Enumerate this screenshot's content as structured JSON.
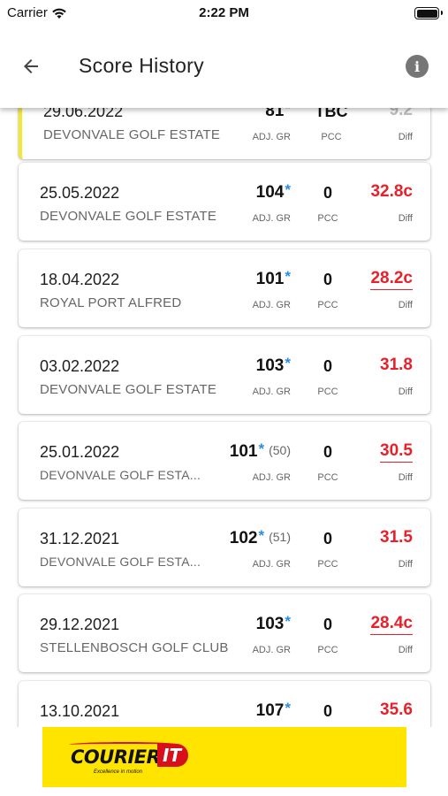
{
  "status_bar": {
    "carrier": "Carrier",
    "time": "2:22 PM"
  },
  "app_bar": {
    "title": "Score History",
    "info_glyph": "i"
  },
  "labels": {
    "adj": "ADJ. GR",
    "pcc": "PCC",
    "diff": "Diff"
  },
  "scores": [
    {
      "date": "29.06.2022",
      "course": "DEVONVALE GOLF ESTATE",
      "adj_gross": "81",
      "starred": true,
      "previous": "",
      "pcc": "TBC",
      "diff": "9.2",
      "diff_style": "faded",
      "underlined": false,
      "highlighted": true
    },
    {
      "date": "25.05.2022",
      "course": "DEVONVALE GOLF ESTATE",
      "adj_gross": "104",
      "starred": true,
      "previous": "",
      "pcc": "0",
      "diff": "32.8c",
      "diff_style": "red",
      "underlined": false,
      "highlighted": false
    },
    {
      "date": "18.04.2022",
      "course": "ROYAL PORT ALFRED",
      "adj_gross": "101",
      "starred": true,
      "previous": "",
      "pcc": "0",
      "diff": "28.2c",
      "diff_style": "red",
      "underlined": true,
      "highlighted": false
    },
    {
      "date": "03.02.2022",
      "course": "DEVONVALE GOLF ESTATE",
      "adj_gross": "103",
      "starred": true,
      "previous": "",
      "pcc": "0",
      "diff": "31.8",
      "diff_style": "red",
      "underlined": false,
      "highlighted": false
    },
    {
      "date": "25.01.2022",
      "course": "DEVONVALE GOLF ESTA...",
      "adj_gross": "101",
      "starred": true,
      "previous": "(50)",
      "pcc": "0",
      "diff": "30.5",
      "diff_style": "red",
      "underlined": true,
      "highlighted": false
    },
    {
      "date": "31.12.2021",
      "course": "DEVONVALE GOLF ESTA...",
      "adj_gross": "102",
      "starred": true,
      "previous": "(51)",
      "pcc": "0",
      "diff": "31.5",
      "diff_style": "red",
      "underlined": false,
      "highlighted": false
    },
    {
      "date": "29.12.2021",
      "course": "STELLENBOSCH GOLF CLUB",
      "adj_gross": "103",
      "starred": true,
      "previous": "",
      "pcc": "0",
      "diff": "28.4c",
      "diff_style": "red",
      "underlined": true,
      "highlighted": false
    },
    {
      "date": "13.10.2021",
      "course": "",
      "adj_gross": "107",
      "starred": true,
      "previous": "",
      "pcc": "0",
      "diff": "35.6",
      "diff_style": "red",
      "underlined": false,
      "highlighted": false
    }
  ],
  "ad": {
    "brand": "COURIER",
    "brand_suffix": "IT",
    "slogan": "Excellence in motion",
    "bg_color": "#ffe400",
    "accent_color": "#d8101b"
  },
  "colors": {
    "diff_red": "#e8202a",
    "star_blue": "#2b8de0",
    "highlight_yellow": "#f4e731"
  }
}
